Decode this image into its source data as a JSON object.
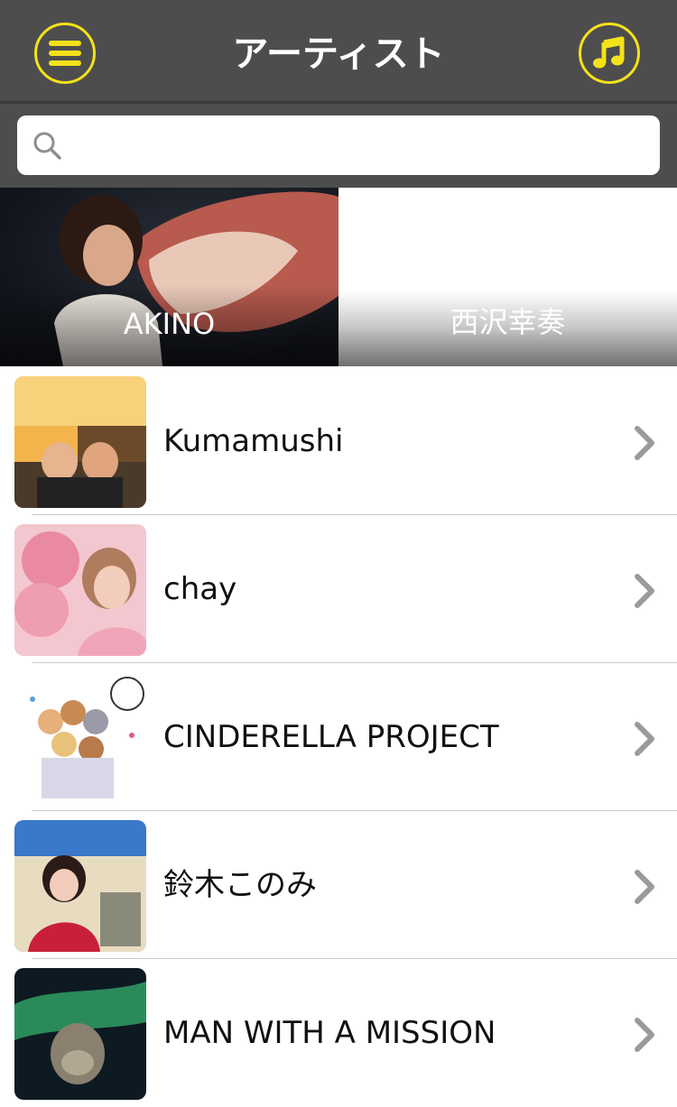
{
  "header": {
    "title": "アーティスト",
    "menu_icon": "hamburger-menu-icon",
    "music_icon": "music-note-icon",
    "accent_color": "#f3e21b",
    "bar_color": "#4d4d4d"
  },
  "search": {
    "placeholder": "",
    "value": "",
    "icon": "search-icon"
  },
  "featured": [
    {
      "label": "AKINO"
    },
    {
      "label": "西沢幸奏"
    }
  ],
  "artists": [
    {
      "name": "Kumamushi"
    },
    {
      "name": "chay"
    },
    {
      "name": "CINDERELLA PROJECT"
    },
    {
      "name": "鈴木このみ"
    },
    {
      "name": "MAN WITH A MISSION"
    }
  ]
}
